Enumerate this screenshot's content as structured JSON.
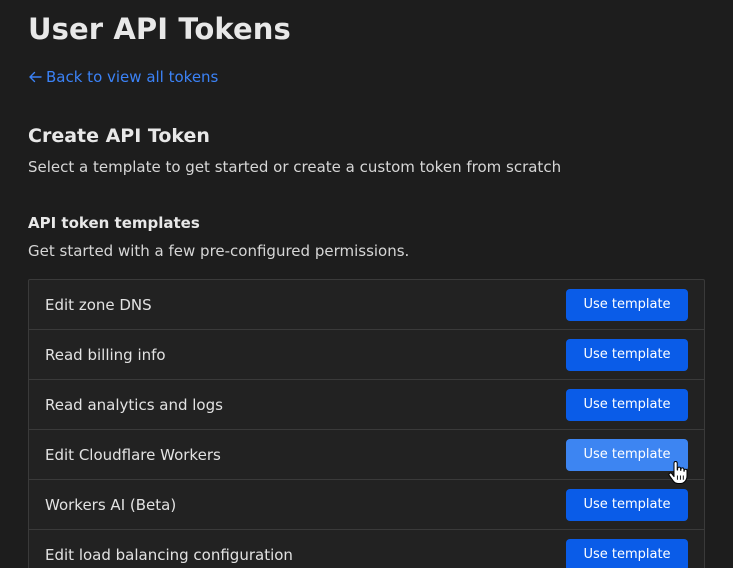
{
  "page": {
    "title": "User API Tokens",
    "back_link": "Back to view all tokens"
  },
  "create": {
    "title": "Create API Token",
    "description": "Select a template to get started or create a custom token from scratch"
  },
  "templates": {
    "heading": "API token templates",
    "description": "Get started with a few pre-configured permissions.",
    "button_label": "Use template",
    "items": [
      {
        "name": "Edit zone DNS",
        "button": "Use template"
      },
      {
        "name": "Read billing info",
        "button": "Use template"
      },
      {
        "name": "Read analytics and logs",
        "button": "Use template"
      },
      {
        "name": "Edit Cloudflare Workers",
        "button": "Use template"
      },
      {
        "name": "Workers AI (Beta)",
        "button": "Use template"
      },
      {
        "name": "Edit load balancing configuration",
        "button": "Use template"
      }
    ]
  },
  "colors": {
    "accent": "#0a5ce8",
    "accent_hover": "#3d85f2",
    "link": "#3b82f6",
    "background": "#1d1d1d"
  },
  "icons": {
    "back": "arrow-left-icon",
    "cursor": "hand-pointer-icon"
  }
}
